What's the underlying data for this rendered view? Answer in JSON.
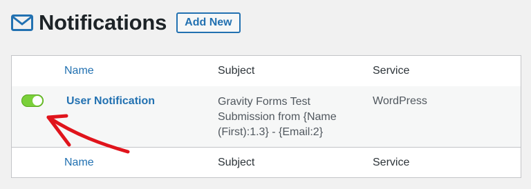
{
  "header": {
    "title": "Notifications",
    "add_new_label": "Add New",
    "icon": "mail-icon"
  },
  "table": {
    "columns": {
      "name": "Name",
      "subject": "Subject",
      "service": "Service"
    },
    "rows": [
      {
        "active": true,
        "name": "User Notification",
        "subject": "Gravity Forms Test Submission from {Name (First):1.3} - {Email:2}",
        "service": "WordPress"
      }
    ],
    "footer": {
      "name": "Name",
      "subject": "Subject",
      "service": "Service"
    }
  },
  "colors": {
    "accent": "#2271b1",
    "toggle_on": "#7ad03a",
    "annotation": "#e0141c"
  }
}
